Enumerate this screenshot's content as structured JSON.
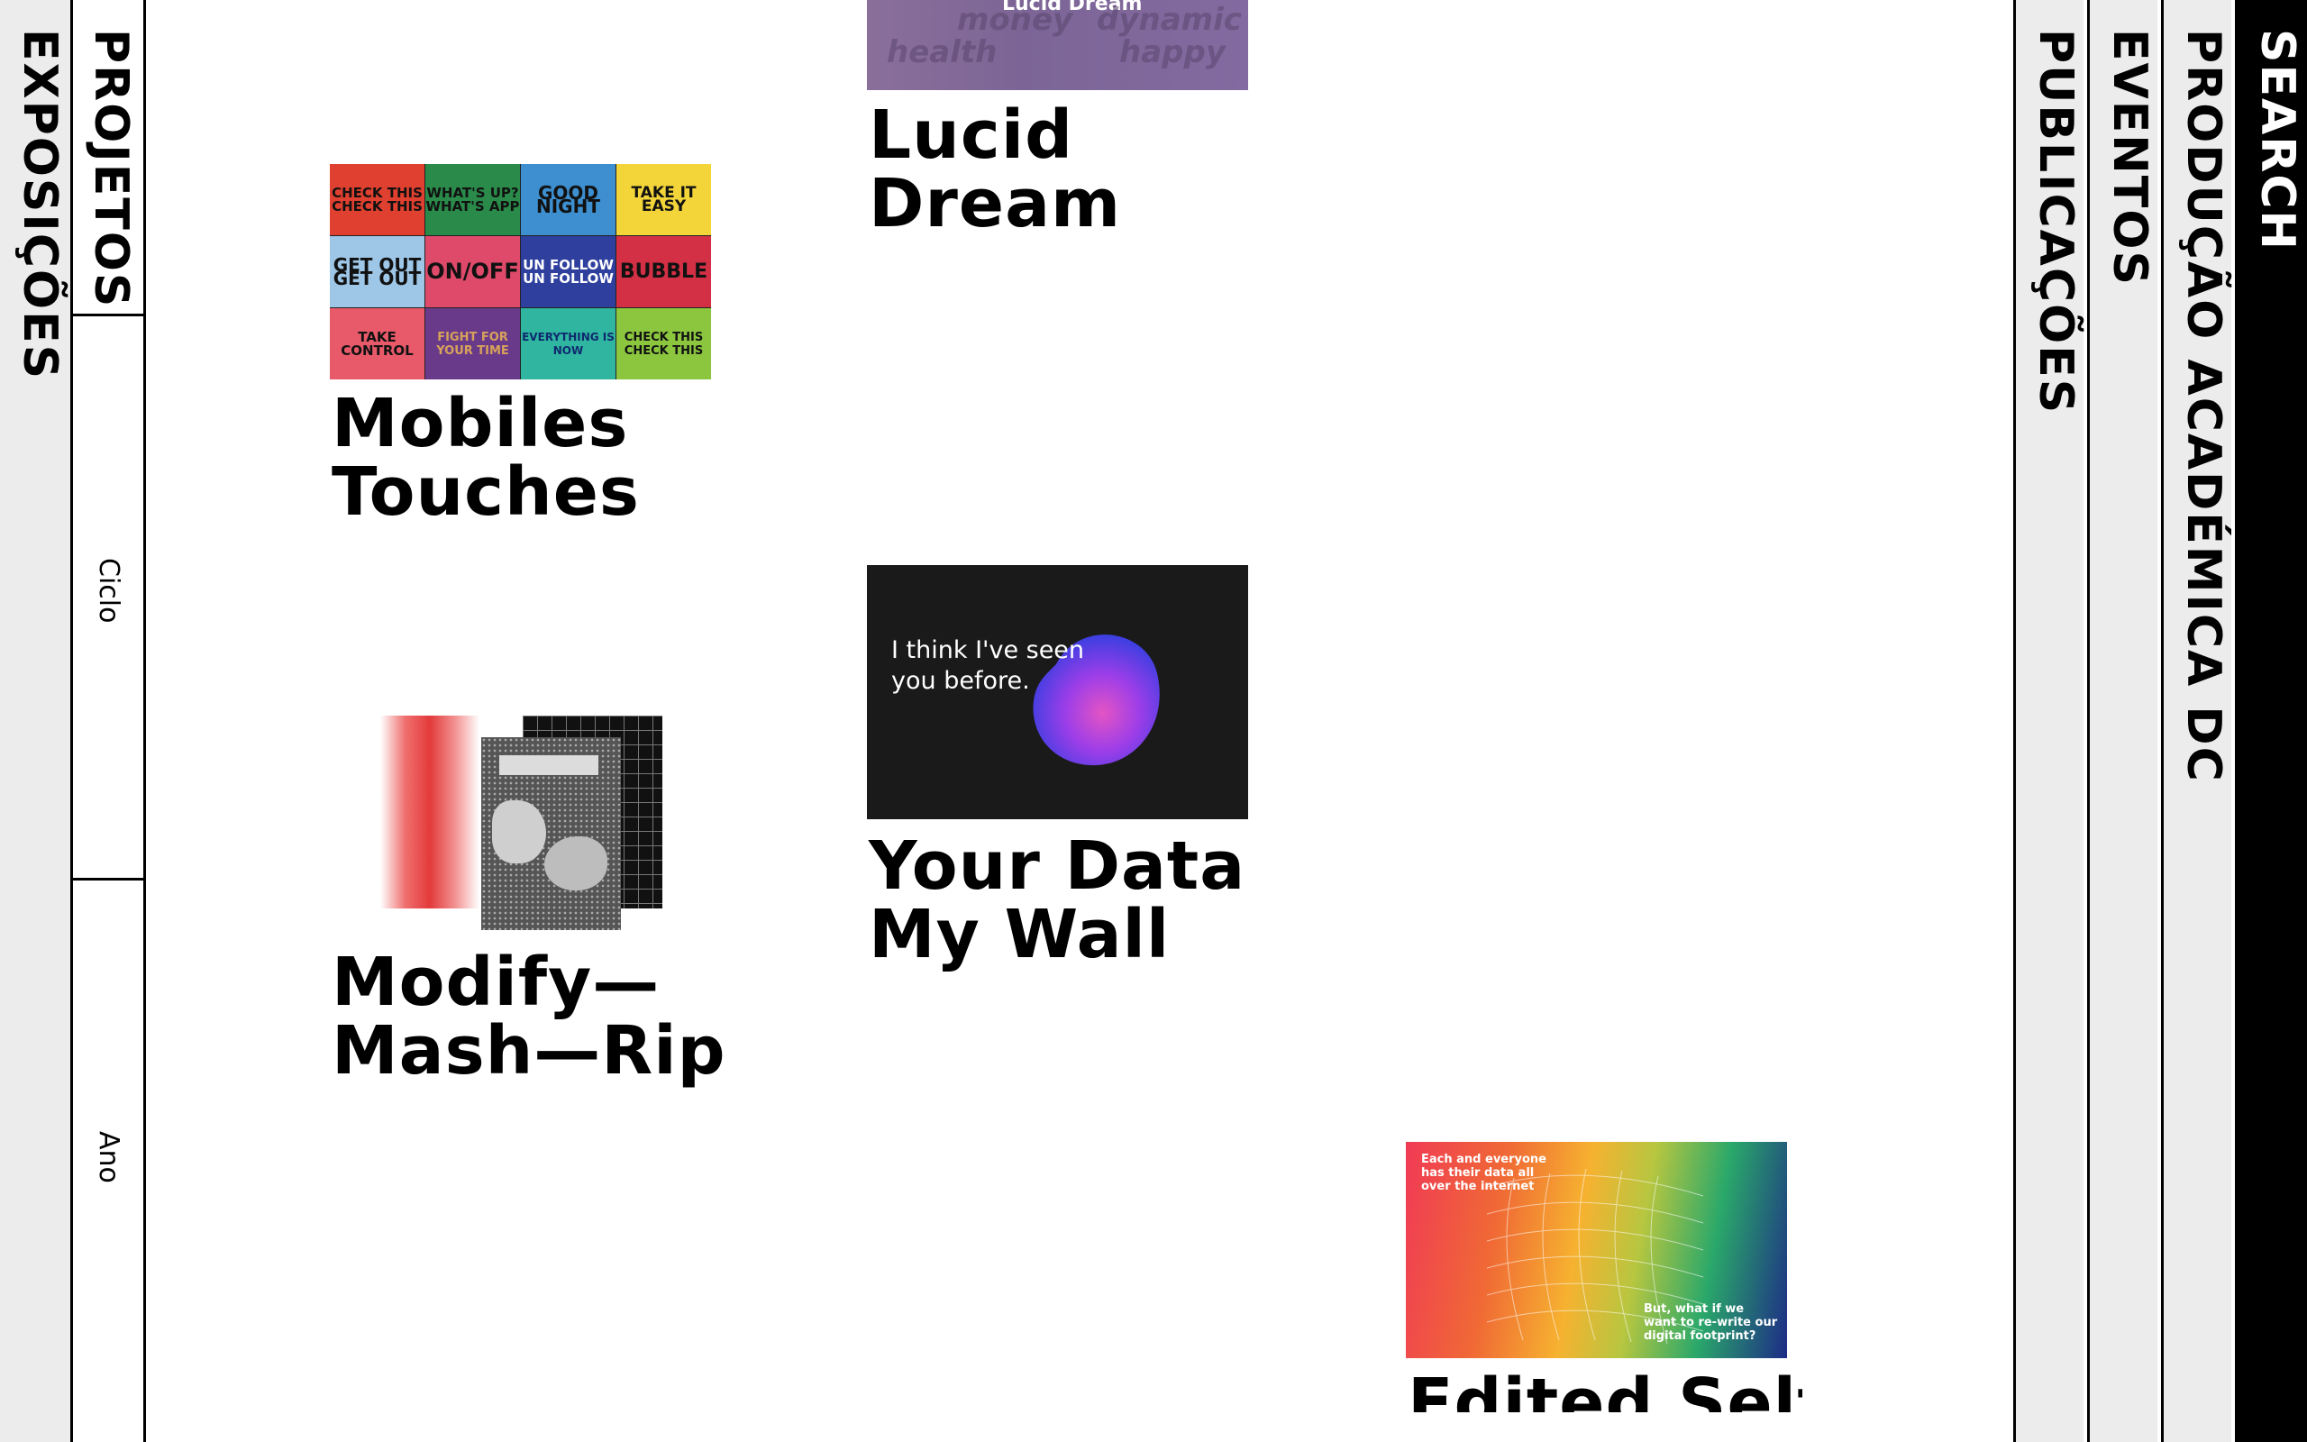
{
  "left_nav": {
    "exposicoes": "EXPOSIÇÕES",
    "projetos": "PROJETOS",
    "filters": {
      "ciclo": "Ciclo",
      "ano": "Ano"
    }
  },
  "right_nav": {
    "publicacoes": "PUBLICAÇÕES",
    "eventos": "EVENTOS",
    "producao": "PRODUÇÃO ACADÉMICA DC",
    "search": "SEARCH"
  },
  "projects": [
    {
      "title_lines": [
        "Lucid",
        "Dream"
      ],
      "thumb_text": {
        "caption": "Lucid Dream",
        "words": [
          "money",
          "dynamic",
          "health",
          "happy"
        ]
      }
    },
    {
      "title_lines": [
        "Mobiles",
        "Touches"
      ],
      "tiles": [
        "CHECK THIS CHECK THIS",
        "WHAT'S UP? WHAT'S APP",
        "GOOD NIGHT",
        "TAKE IT EASY",
        "GET OUT GET OUT",
        "ON/OFF",
        "UN FOLLOW UN FOLLOW",
        "BUBBLE",
        "TAKE CONTROL",
        "FIGHT FOR YOUR TIME",
        "EVERYTHING IS NOW",
        "CHECK THIS CHECK THIS"
      ],
      "tile_colors": [
        "#e0402f",
        "#2a8a4a",
        "#3d8fd0",
        "#f3d53a",
        "#9ec6e6",
        "#e04a6a",
        "#2e3f9e",
        "#d43045",
        "#e85a6a",
        "#6a3a8a",
        "#2fb5a0",
        "#8cc63f"
      ]
    },
    {
      "title_lines": [
        "Your Data",
        "My Wall"
      ],
      "thumb_text": {
        "caption": "I think I've seen you before."
      }
    },
    {
      "title_lines": [
        "Modify—",
        "Mash—Rip"
      ]
    },
    {
      "title_lines": [
        "Edited Self"
      ],
      "thumb_text": {
        "top": "Each and everyone has their data all over the internet",
        "bottom": "But, what if we want to re-write our digital footprint?"
      }
    }
  ]
}
